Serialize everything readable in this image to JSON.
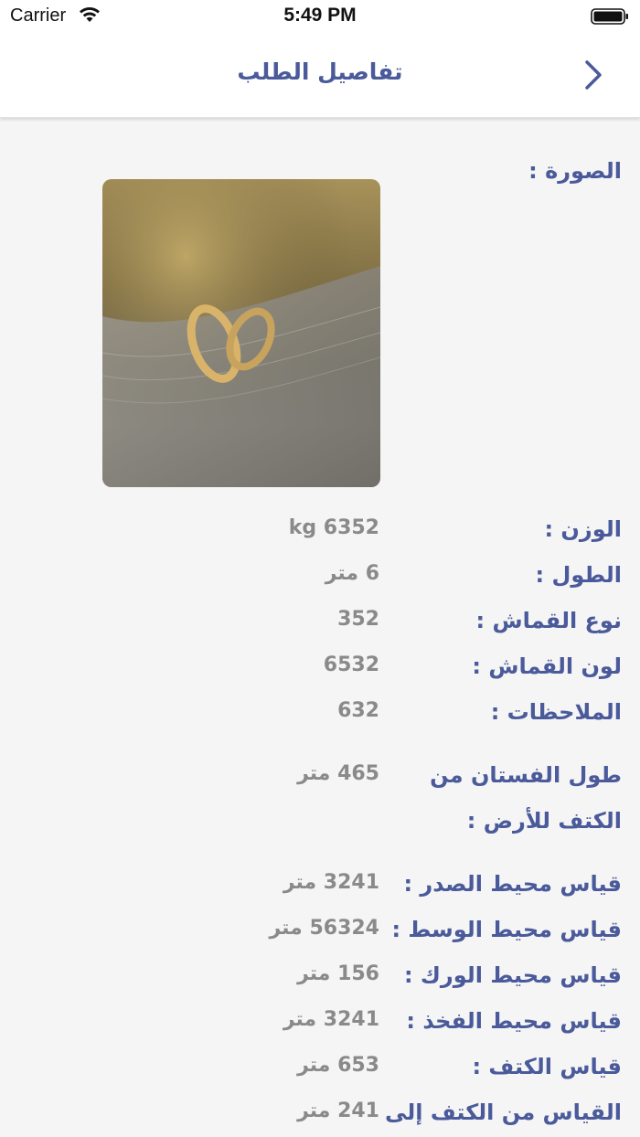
{
  "status_bar": {
    "carrier": "Carrier",
    "time": "5:49 PM",
    "wifi_icon": "wifi-icon",
    "battery_icon": "battery-icon"
  },
  "nav": {
    "title": "تفاصيل الطلب",
    "back_icon": "chevron-right-icon"
  },
  "details": {
    "photo_label": "الصورة :",
    "fields": [
      {
        "label": "الوزن :",
        "value": "kg 6352"
      },
      {
        "label": "الطول :",
        "value": "6 متر"
      },
      {
        "label": "نوع القماش :",
        "value": "352"
      },
      {
        "label": "لون القماش :",
        "value": "6532"
      },
      {
        "label": "الملاحظات :",
        "value": "632"
      },
      {
        "label_line1": "طول الفستان من",
        "label_line2": "الكتف للأرض :",
        "value": "465 متر"
      },
      {
        "label": "قياس محيط الصدر :",
        "value": "3241 متر"
      },
      {
        "label": "قياس محيط الوسط :",
        "value": "56324 متر"
      },
      {
        "label": "قياس محيط الورك :",
        "value": "156 متر"
      },
      {
        "label": "قياس محيط الفخذ :",
        "value": "3241 متر"
      },
      {
        "label": "قياس الكتف :",
        "value": "653 متر"
      },
      {
        "label": "القياس من الكتف إلى",
        "value": "241 متر"
      }
    ]
  },
  "colors": {
    "accent": "#4a5a9a",
    "value_gray": "#8a8a8a",
    "background": "#f5f5f5"
  }
}
